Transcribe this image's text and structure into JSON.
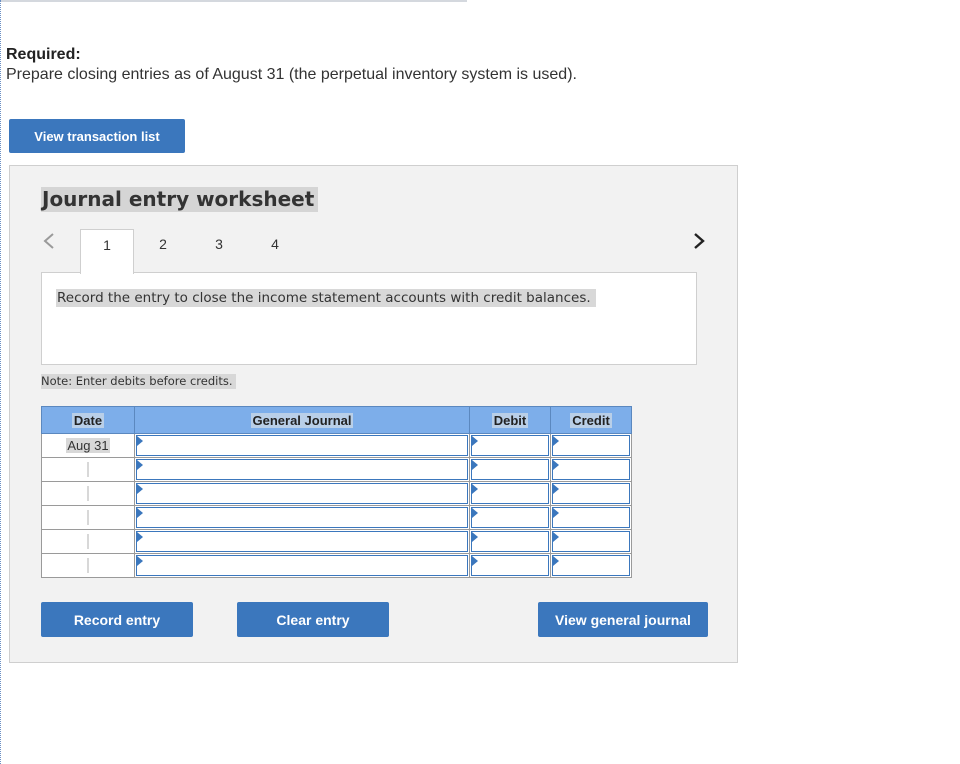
{
  "header": {
    "required_label": "Required:",
    "instructions": "Prepare closing entries as of August 31 (the perpetual inventory system is used)."
  },
  "buttons": {
    "view_transaction_list": "View transaction list",
    "record_entry": "Record entry",
    "clear_entry": "Clear entry",
    "view_general_journal": "View general journal"
  },
  "worksheet": {
    "title": "Journal entry worksheet",
    "tabs": [
      {
        "label": "1",
        "active": true
      },
      {
        "label": "2",
        "active": false
      },
      {
        "label": "3",
        "active": false
      },
      {
        "label": "4",
        "active": false
      }
    ],
    "prompt": "Record the entry to close the income statement accounts with credit balances.",
    "note": "Note: Enter debits before credits."
  },
  "journal": {
    "columns": [
      "Date",
      "General Journal",
      "Debit",
      "Credit"
    ],
    "rows": [
      {
        "date": "Aug 31",
        "account": "",
        "debit": "",
        "credit": ""
      },
      {
        "date": "",
        "account": "",
        "debit": "",
        "credit": ""
      },
      {
        "date": "",
        "account": "",
        "debit": "",
        "credit": ""
      },
      {
        "date": "",
        "account": "",
        "debit": "",
        "credit": ""
      },
      {
        "date": "",
        "account": "",
        "debit": "",
        "credit": ""
      },
      {
        "date": "",
        "account": "",
        "debit": "",
        "credit": ""
      }
    ]
  },
  "icons": {
    "prev": "chevron-left-icon",
    "next": "chevron-right-icon",
    "cell_marker": "dropdown-triangle-icon"
  },
  "colors": {
    "button": "#3b77bd",
    "table_header": "#7daeea",
    "panel_bg": "#f2f2f2"
  }
}
